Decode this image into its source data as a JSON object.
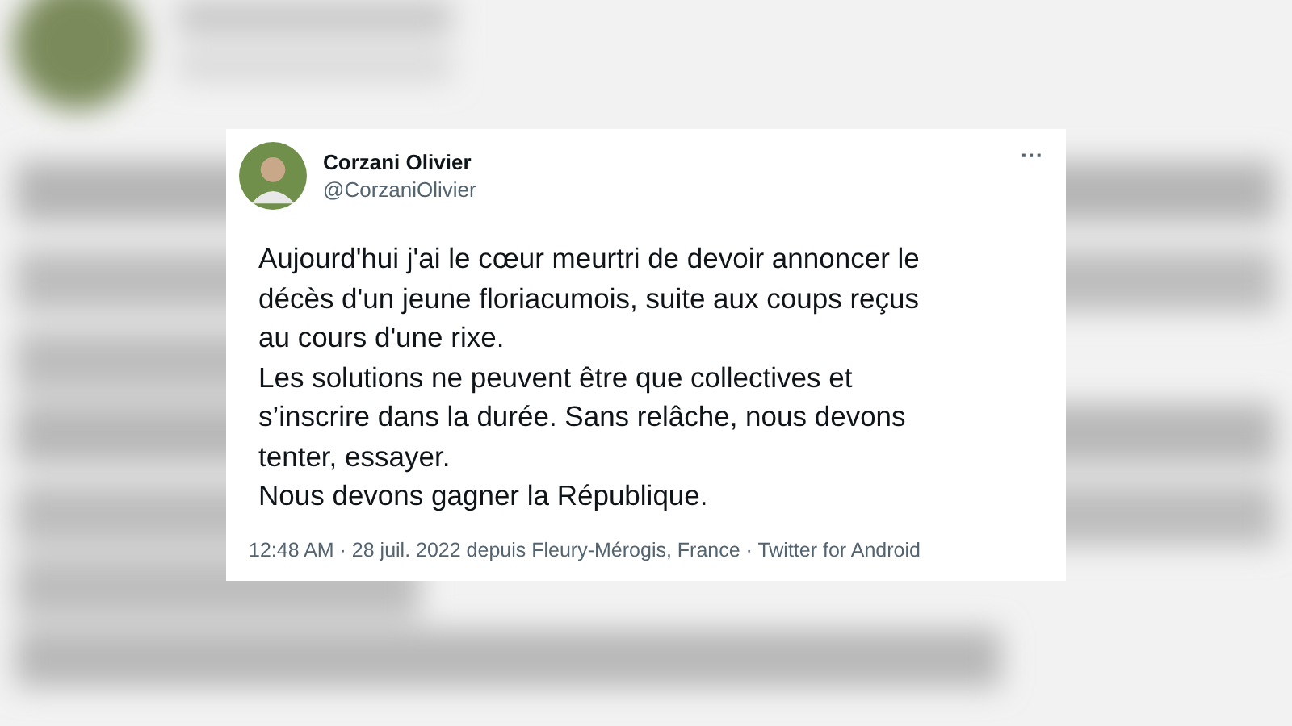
{
  "tweet": {
    "author": "Corzani Olivier",
    "handle": "@CorzaniOlivier",
    "menu": "···",
    "lines": [
      "Aujourd'hui j'ai le cœur meurtri de devoir annoncer le",
      "décès d'un jeune floriacumois, suite aux coups reçus",
      "au cours d'une rixe.",
      "Les solutions ne peuvent être que collectives et",
      "s’inscrire dans la durée. Sans relâche, nous devons",
      "tenter, essayer.",
      "Nous devons gagner la République."
    ],
    "meta": "12:48 AM · 28 juil. 2022 depuis Fleury-Mérogis, France · Twitter for Android"
  }
}
